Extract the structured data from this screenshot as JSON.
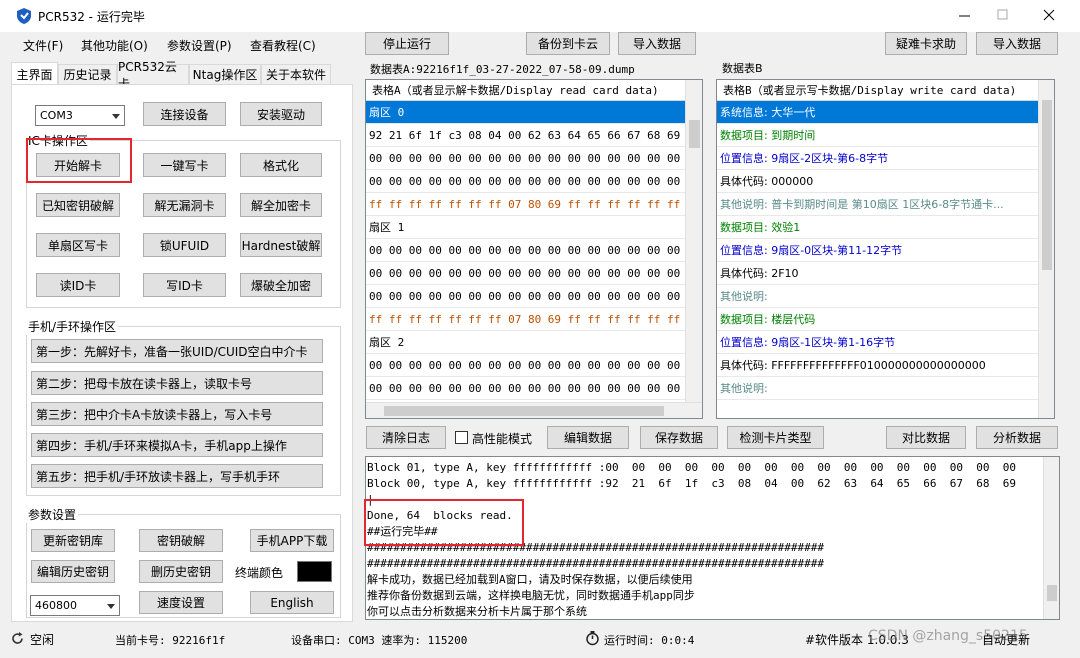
{
  "window": {
    "title": "PCR532 - 运行完毕"
  },
  "menu": {
    "file": "文件(F)",
    "other": "其他功能(O)",
    "params": "参数设置(P)",
    "tutorial": "查看教程(C)"
  },
  "toolbar": {
    "stop": "停止运行",
    "backup": "备份到卡云",
    "import": "导入数据",
    "help": "疑难卡求助",
    "import2": "导入数据"
  },
  "tabs": [
    "主界面",
    "历史记录",
    "PCR532云卡",
    "Ntag操作区",
    "关于本软件"
  ],
  "port": {
    "com": "COM3",
    "connect": "连接设备",
    "driver": "安装驱动"
  },
  "ic": {
    "title": "IC卡操作区",
    "start": "开始解卡",
    "write": "一键写卡",
    "format": "格式化",
    "known": "已知密钥破解",
    "nohole": "解无漏洞卡",
    "fullenc": "解全加密卡",
    "sector": "单扇区写卡",
    "lockufuid": "锁UFUID",
    "hardnest": "Hardnest破解",
    "readid": "读ID卡",
    "writeid": "写ID卡",
    "burst": "爆破全加密"
  },
  "phone": {
    "title": "手机/手环操作区",
    "steps": [
      "第一步：先解好卡，准备一张UID/CUID空白中介卡",
      "第二步：把母卡放在读卡器上，读取卡号",
      "第三步：把中介卡A卡放读卡器上，写入卡号",
      "第四步：手机/手环来模拟A卡，手机app上操作",
      "第五步：把手机/手环放读卡器上，写手机手环"
    ]
  },
  "params": {
    "title": "参数设置",
    "updatekeys": "更新密钥库",
    "crack": "密钥破解",
    "appdl": "手机APP下载",
    "edithist": "编辑历史密钥",
    "delhist": "删历史密钥",
    "termcolor": "终端颜色",
    "baud": "460800",
    "speed": "速度设置",
    "lang": "English"
  },
  "tableA": {
    "label": "数据表A:92216f1f_03-27-2022_07-58-09.dump",
    "header": "表格A（或者显示解卡数据/Display read card data)",
    "rows": [
      {
        "text": "扇区 0",
        "kind": "sel"
      },
      {
        "text": "92 21 6f 1f c3 08 04 00 62 63 64 65 66 67 68 69",
        "kind": "data"
      },
      {
        "text": "00 00 00 00 00 00 00 00 00 00 00 00 00 00 00 00",
        "kind": "data"
      },
      {
        "text": "00 00 00 00 00 00 00 00 00 00 00 00 00 00 00 00",
        "kind": "data"
      },
      {
        "text": "ff ff ff ff ff ff ff 07 80 69 ff ff ff ff ff ff",
        "kind": "key"
      },
      {
        "text": "扇区 1",
        "kind": "sector"
      },
      {
        "text": "00 00 00 00 00 00 00 00 00 00 00 00 00 00 00 00",
        "kind": "data"
      },
      {
        "text": "00 00 00 00 00 00 00 00 00 00 00 00 00 00 00 00",
        "kind": "data"
      },
      {
        "text": "00 00 00 00 00 00 00 00 00 00 00 00 00 00 00 00",
        "kind": "data"
      },
      {
        "text": "ff ff ff ff ff ff ff 07 80 69 ff ff ff ff ff ff",
        "kind": "key"
      },
      {
        "text": "扇区 2",
        "kind": "sector"
      },
      {
        "text": "00 00 00 00 00 00 00 00 00 00 00 00 00 00 00 00",
        "kind": "data"
      },
      {
        "text": "00 00 00 00 00 00 00 00 00 00 00 00 00 00 00 00",
        "kind": "data"
      }
    ]
  },
  "tableB": {
    "label": "数据表B",
    "header": "表格B（或者显示写卡数据/Display write card data)",
    "rows": [
      {
        "text": "系统信息:  大华一代",
        "kind": "sel"
      },
      {
        "text": "数据项目:  到期时间",
        "kind": "green"
      },
      {
        "text": "位置信息:  9扇区-2区块-第6-8字节",
        "kind": "blue"
      },
      {
        "text": "具体代码:  000000",
        "kind": "black"
      },
      {
        "text": "其他说明:  普卡到期时间是 第10扇区 1区块6-8字节通卡...",
        "kind": "teal"
      },
      {
        "text": "数据项目:  效验1",
        "kind": "green"
      },
      {
        "text": "位置信息:  9扇区-0区块-第11-12字节",
        "kind": "blue"
      },
      {
        "text": "具体代码:  2F10",
        "kind": "black"
      },
      {
        "text": "其他说明:",
        "kind": "teal"
      },
      {
        "text": "数据项目:  楼层代码",
        "kind": "green"
      },
      {
        "text": "位置信息:  9扇区-1区块-第1-16字节",
        "kind": "blue"
      },
      {
        "text": "具体代码:  FFFFFFFFFFFFFF010000000000000000",
        "kind": "black"
      },
      {
        "text": "其他说明:",
        "kind": "teal"
      }
    ]
  },
  "actions": {
    "clearlog": "清除日志",
    "perf": "高性能模式",
    "edit": "编辑数据",
    "save": "保存数据",
    "detect": "检测卡片类型",
    "compare": "对比数据",
    "analyze": "分析数据"
  },
  "log": [
    "Block 01, type A, key ffffffffffff :00  00  00  00  00  00  00  00  00  00  00  00  00  00  00  00",
    "Block 00, type A, key ffffffffffff :92  21  6f  1f  c3  08  04  00  62  63  64  65  66  67  68  69",
    "|",
    "Done, 64  blocks read.",
    "##运行完毕##",
    "#####################################################################",
    "#####################################################################",
    "解卡成功，数据已经加载到A窗口，请及时保存数据，以便后续使用",
    "推荐你备份数据到云端，这样换电脑无忧，同时数据通手机app同步",
    "你可以点击分析数据来分析卡片属于那个系统"
  ],
  "status": {
    "idle": "空闲",
    "cardno": "当前卡号: 92216f1f",
    "serial": "设备串口: COM3 速率为: 115200",
    "runtime": "运行时间: 0:0:4",
    "version": "#软件版本 1.0.0.3",
    "watermark": "CSDN @zhang_s50215",
    "autoupdate": "自动更新"
  },
  "colors": {
    "selection": "#0078d7",
    "red_box": "#e6262f",
    "key_row": "#c05000"
  }
}
